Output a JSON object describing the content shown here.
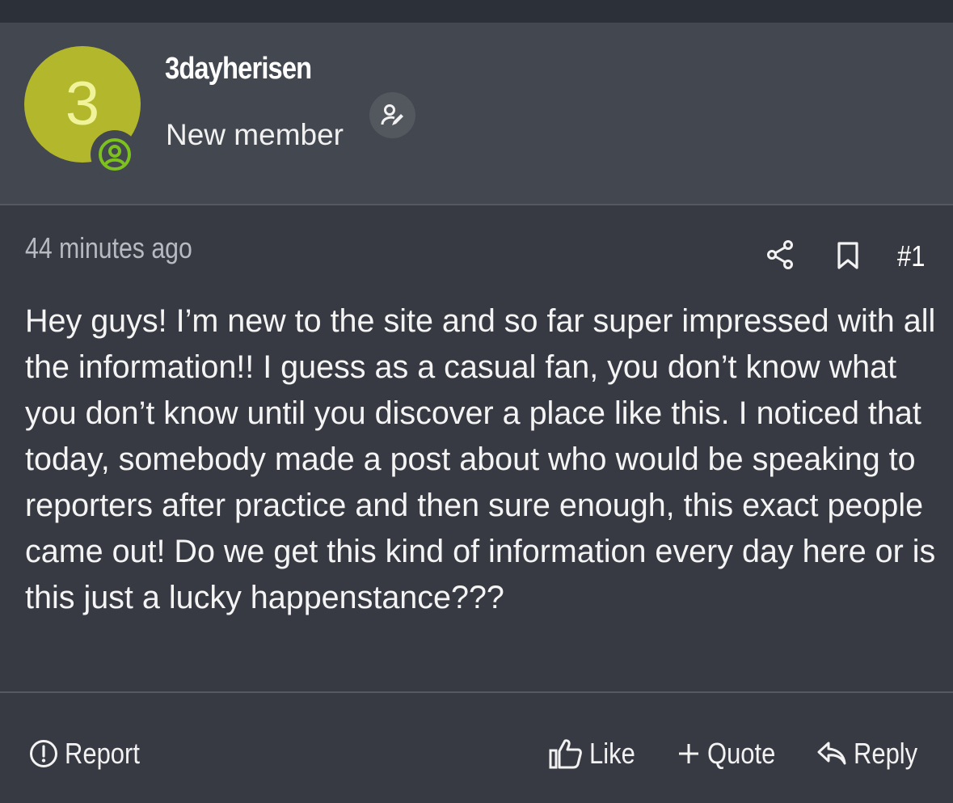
{
  "user": {
    "avatar_letter": "3",
    "avatar_color": "#b3b72c",
    "username": "3dayherisen",
    "title": "New member",
    "online_badge_color": "#7cc11e"
  },
  "post": {
    "time": "44 minutes ago",
    "number": "#1",
    "body": "Hey guys! I’m new to the site and so far super impressed with all the information!! I guess as a casual fan, you don’t know what you don’t know until you discover a place like this. I noticed that today, somebody made a post about who would be speaking to reporters after practice and then sure enough, this exact people came out! Do we get this kind of information every day here or is this just a lucky happenstance???"
  },
  "actions": {
    "report": "Report",
    "like": "Like",
    "quote": "Quote",
    "reply": "Reply"
  },
  "icons": [
    "person-circle-icon",
    "edit-user-icon",
    "share-icon",
    "bookmark-icon",
    "report-icon",
    "like-icon",
    "plus-icon",
    "reply-icon"
  ]
}
